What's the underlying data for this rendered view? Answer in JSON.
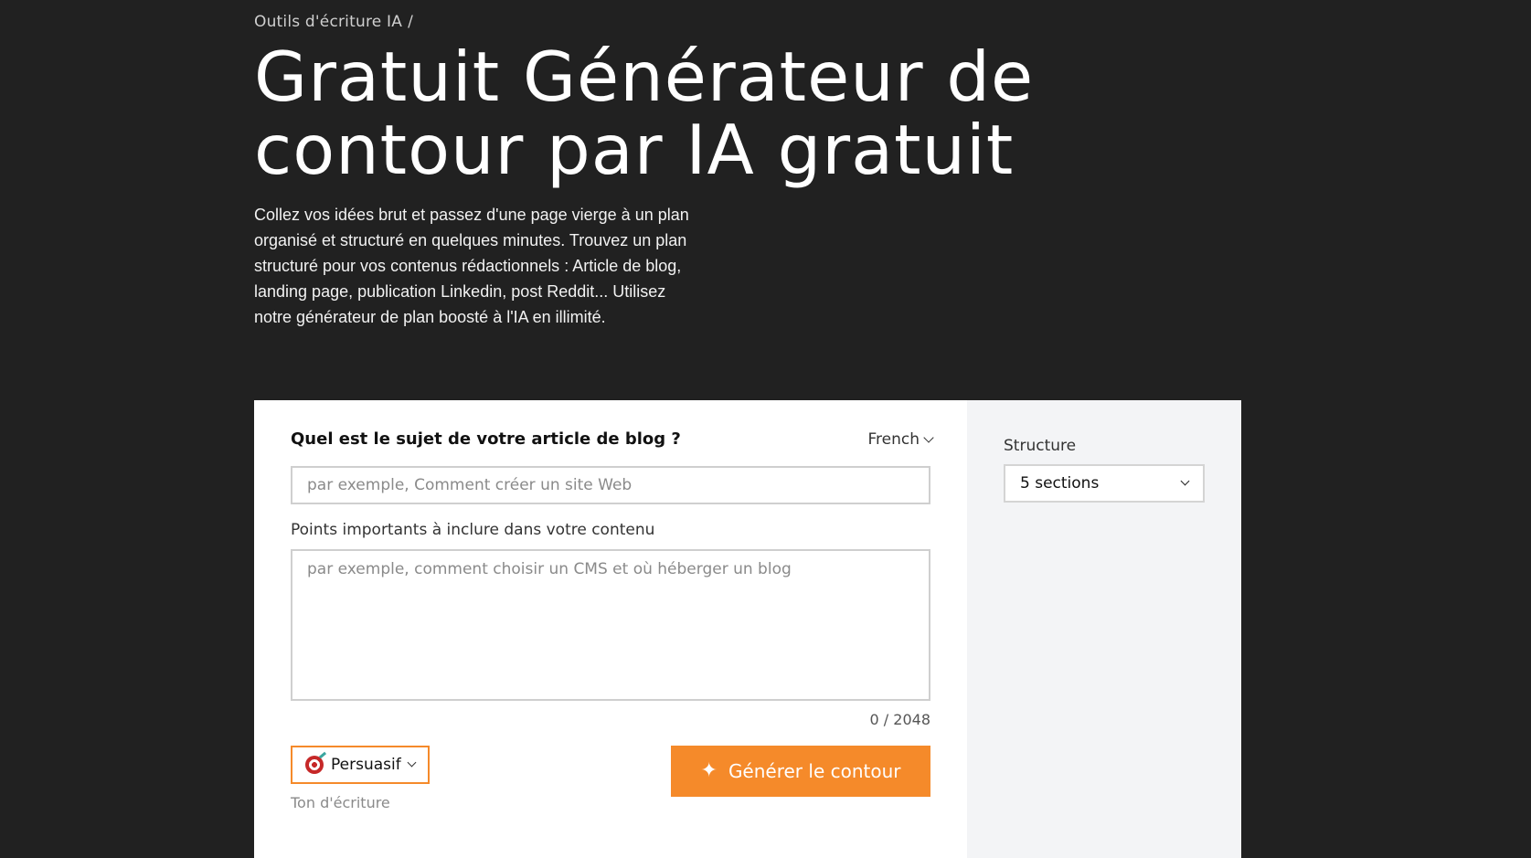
{
  "breadcrumb": {
    "item": "Outils d'écriture IA",
    "separator": "/"
  },
  "hero": {
    "title": "Gratuit Générateur de contour par IA gratuit",
    "subtitle": "Collez vos idées brut et passez d'une page vierge à un plan organisé et structuré en quelques minutes. Trouvez un plan structuré pour vos contenus rédactionnels : Article de blog, landing page, publication Linkedin, post Reddit... Utilisez notre générateur de plan boosté à l'IA en illimité."
  },
  "form": {
    "question_label": "Quel est le sujet de votre article de blog ?",
    "language": {
      "selected": "French",
      "icon": "chevron-down-icon"
    },
    "subject": {
      "value": "",
      "placeholder": "par exemple, Comment créer un site Web"
    },
    "points": {
      "label": "Points importants à inclure dans votre contenu",
      "value": "",
      "placeholder": "par exemple, comment choisir un CMS et où héberger un blog"
    },
    "counter": "0 / 2048",
    "tone": {
      "selected": "Persuasif",
      "icon": "target-icon",
      "caption": "Ton d'écriture"
    },
    "generate_button": {
      "label": "Générer le contour",
      "icon": "sparkle-icon"
    }
  },
  "sidebar": {
    "structure_label": "Structure",
    "structure_selected": "5 sections"
  },
  "colors": {
    "background": "#212121",
    "accent": "#f58a2a",
    "card": "#ffffff",
    "sidebar": "#f3f4f6"
  }
}
